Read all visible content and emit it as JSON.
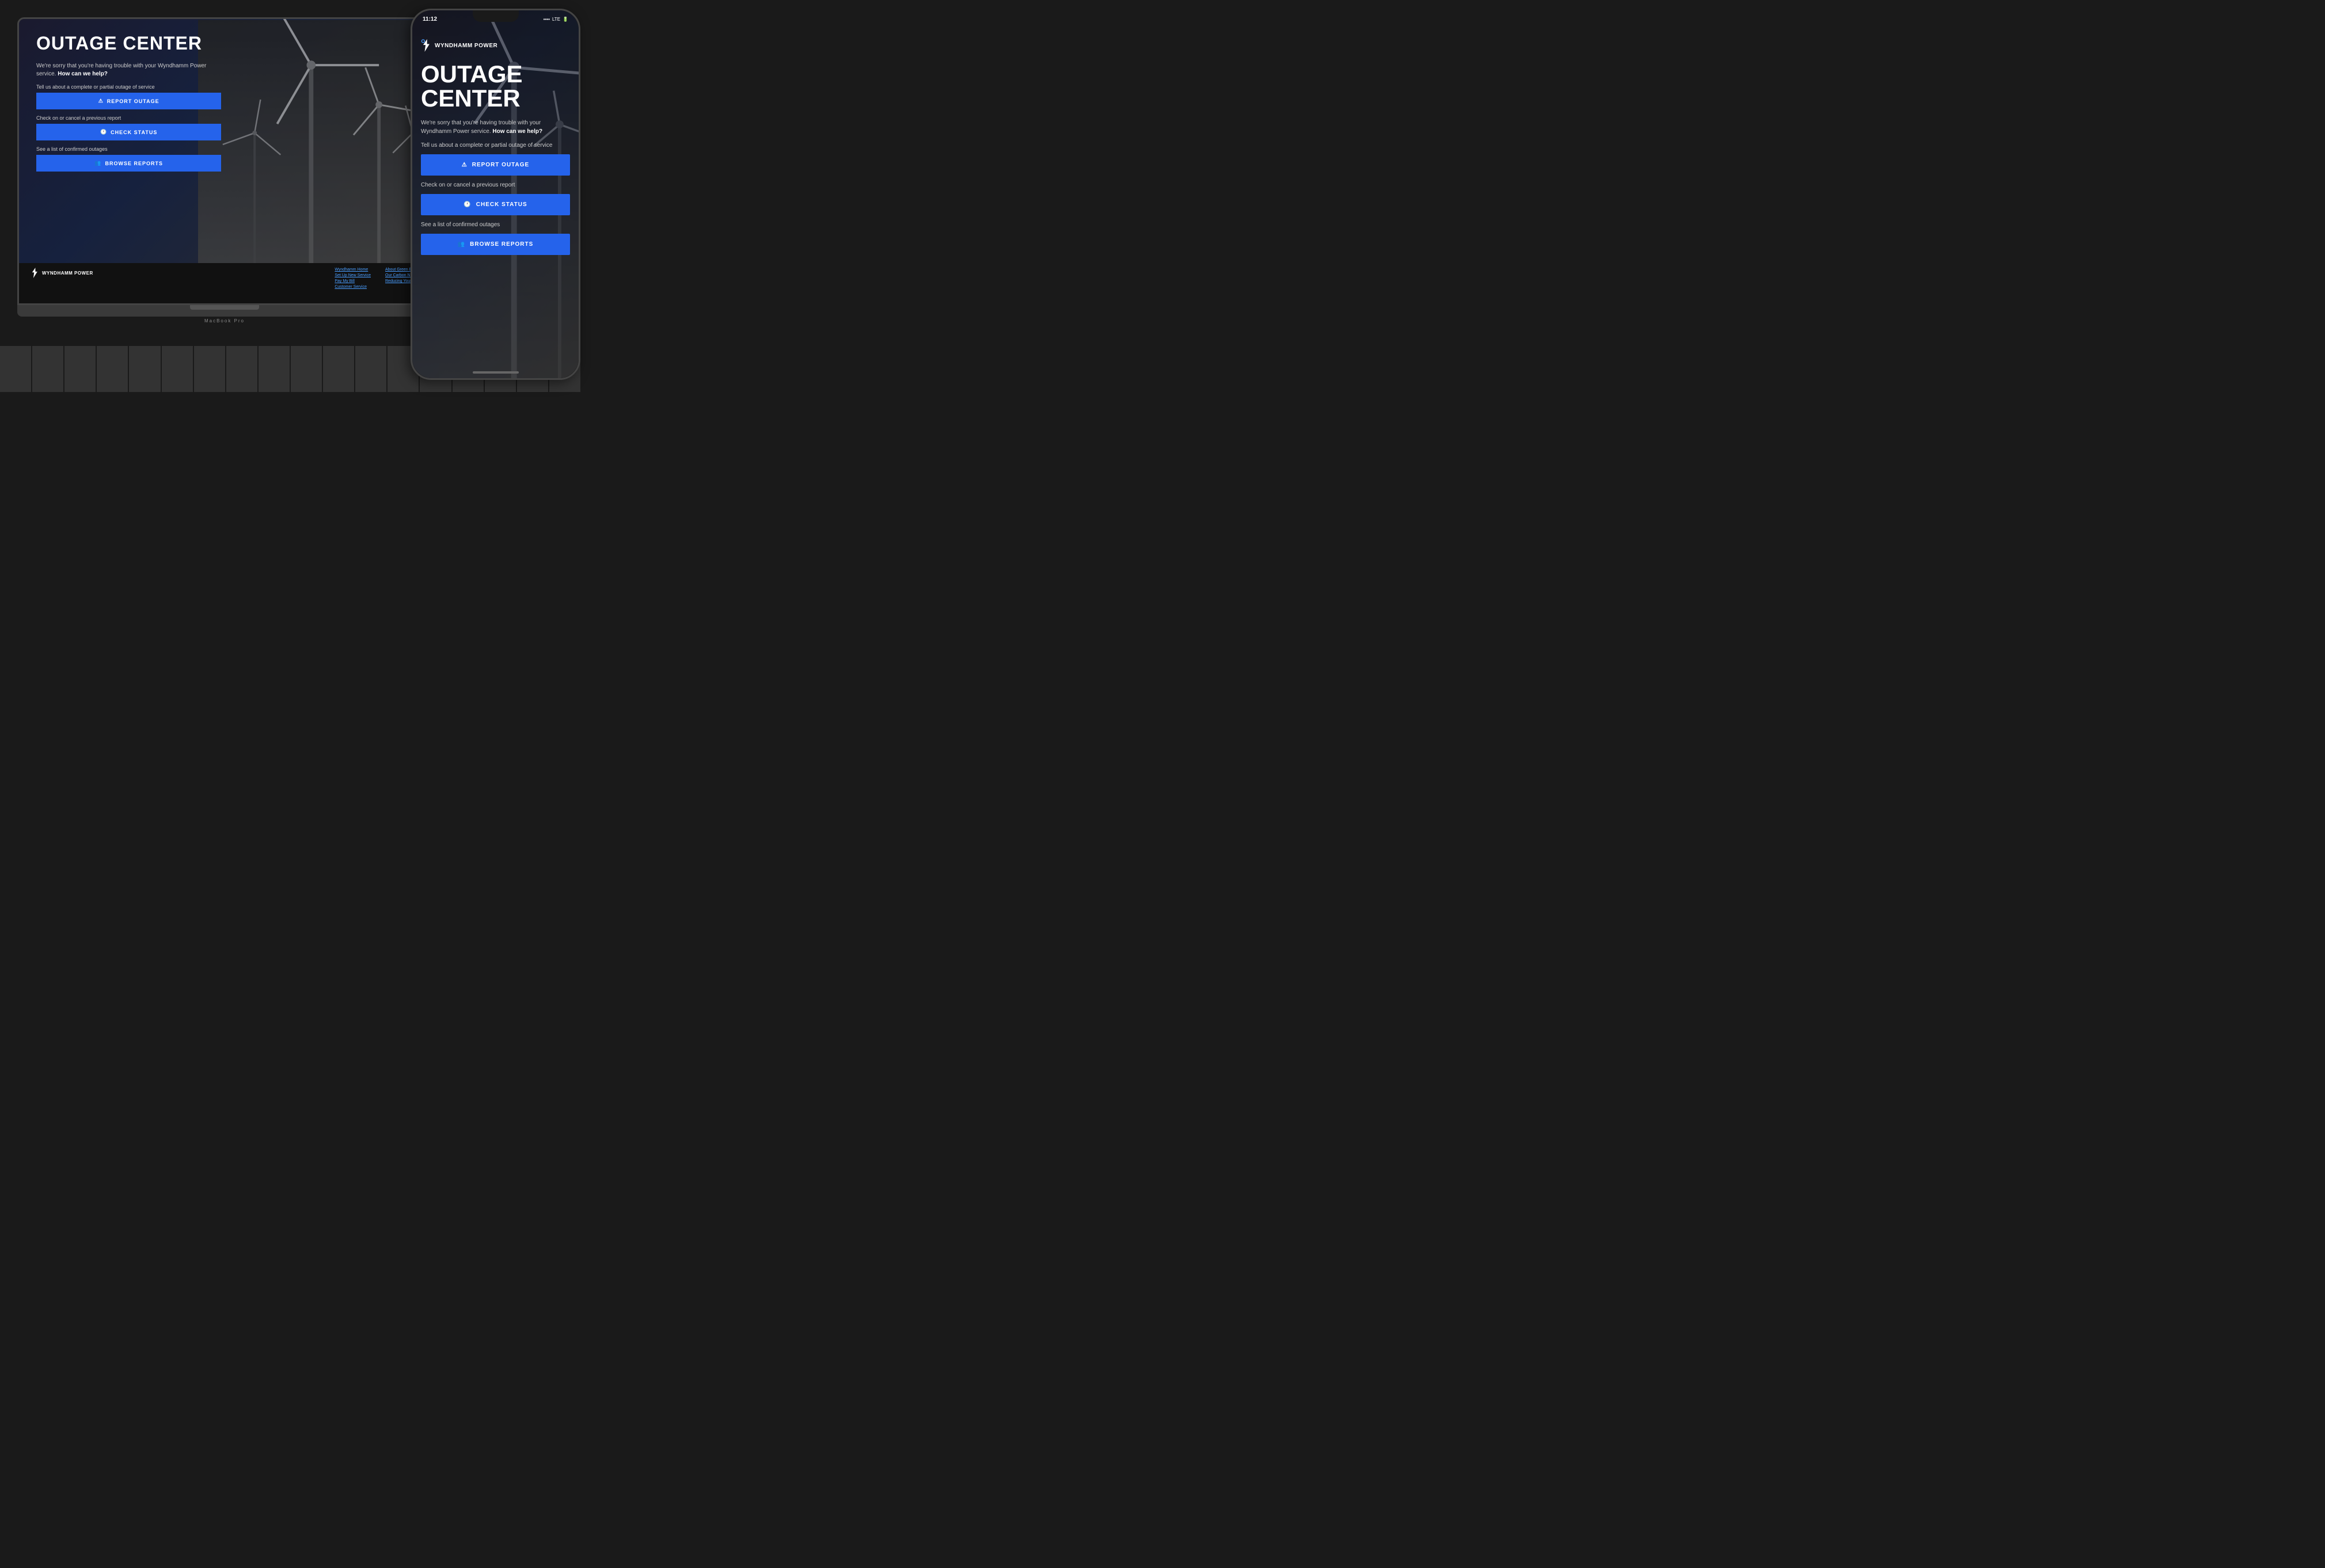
{
  "brand": {
    "name": "WYNDHAMM POWER",
    "logo_alt": "lightning bolt"
  },
  "laptop": {
    "page_title": "OUTAGE CENTER",
    "subtitle_normal": "We're sorry that you're having trouble with your Wyndhamm Power service.",
    "subtitle_bold": "How can we help?",
    "report_label": "Tell us about a complete or partial outage of service",
    "report_btn": "REPORT OUTAGE",
    "status_label": "Check on or cancel a previous report",
    "status_btn": "CHECK STATUS",
    "browse_label": "See a list of confirmed outages",
    "browse_btn": "BROWSE REPORTS",
    "macbook_label": "MacBook Pro"
  },
  "laptop_footer": {
    "brand": "WYNDHAMM POWER",
    "links_col1": [
      "Wyndhamm Home",
      "Set Up New Service",
      "Pay My Bill",
      "Customer Service"
    ],
    "links_col2": [
      "About Green En...",
      "Our Carbon Neu...",
      "Reducing Your B..."
    ]
  },
  "phone": {
    "time": "11:12",
    "signal": "▪▪▪▪",
    "network": "LTE",
    "battery": "▮",
    "brand": "WYNDHAMM POWER",
    "page_title_line1": "OUTAGE",
    "page_title_line2": "CENTER",
    "subtitle_normal": "We're sorry that you're having trouble with your Wyndhamm Power service.",
    "subtitle_bold": "How can we help?",
    "report_label": "Tell us about a complete or partial outage of service",
    "report_btn": "REPORT OUTAGE",
    "status_label": "Check on or cancel a previous report",
    "status_btn": "CHECK STATUS",
    "browse_label": "See a list of confirmed outages",
    "browse_btn": "BROWSE REPORTS"
  }
}
